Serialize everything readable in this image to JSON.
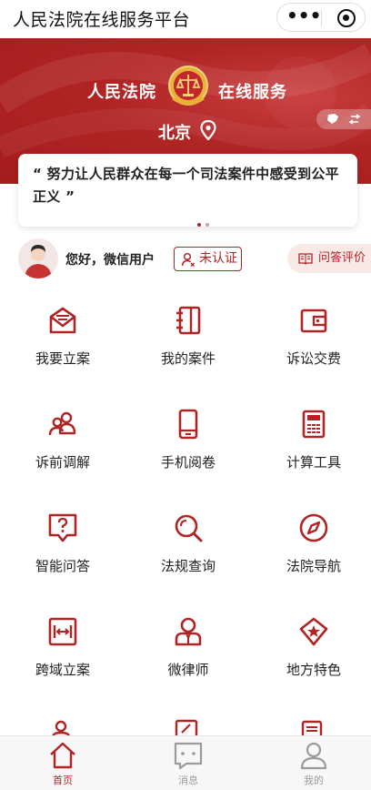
{
  "app": {
    "title": "人民法院在线服务平台"
  },
  "capsule": {
    "more_label": "•••"
  },
  "banner": {
    "title_left": "人民法院",
    "title_right": "在线服务",
    "city": "北京",
    "quote": "“ 努力让人民群众在每一个司法案件中感受到公平正义 ”"
  },
  "user": {
    "greeting": "您好，微信用户",
    "verify_label": "未认证",
    "qa_label": "问答评价"
  },
  "services": [
    {
      "label": "我要立案",
      "icon": "envelope-icon"
    },
    {
      "label": "我的案件",
      "icon": "notebook-icon"
    },
    {
      "label": "诉讼交费",
      "icon": "wallet-icon"
    },
    {
      "label": "诉前调解",
      "icon": "people-icon"
    },
    {
      "label": "手机阅卷",
      "icon": "phone-icon"
    },
    {
      "label": "计算工具",
      "icon": "calculator-icon"
    },
    {
      "label": "智能问答",
      "icon": "question-icon"
    },
    {
      "label": "法规查询",
      "icon": "search-icon"
    },
    {
      "label": "法院导航",
      "icon": "compass-icon"
    },
    {
      "label": "跨域立案",
      "icon": "cross-region-icon"
    },
    {
      "label": "微律师",
      "icon": "lawyer-icon"
    },
    {
      "label": "地方特色",
      "icon": "star-shield-icon"
    }
  ],
  "tabs": [
    {
      "label": "首页",
      "icon": "home-icon",
      "active": true
    },
    {
      "label": "消息",
      "icon": "message-icon",
      "active": false
    },
    {
      "label": "我的",
      "icon": "profile-icon",
      "active": false
    }
  ],
  "colors": {
    "brand_red": "#b12424",
    "tab_inactive": "#9a9a9a"
  }
}
